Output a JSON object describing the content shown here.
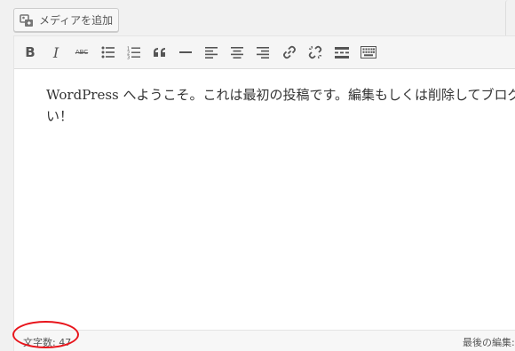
{
  "media_button": {
    "label": "メディアを追加",
    "icon": "add-media-icon"
  },
  "toolbar": {
    "buttons": [
      {
        "name": "bold",
        "icon": "bold-icon",
        "glyph": "B"
      },
      {
        "name": "italic",
        "icon": "italic-icon",
        "glyph": "I"
      },
      {
        "name": "strikethrough",
        "icon": "strikethrough-icon",
        "glyph": "ABC"
      },
      {
        "name": "bullet-list",
        "icon": "bullet-list-icon"
      },
      {
        "name": "numbered-list",
        "icon": "numbered-list-icon"
      },
      {
        "name": "blockquote",
        "icon": "blockquote-icon",
        "glyph": "“"
      },
      {
        "name": "horizontal-line",
        "icon": "horizontal-line-icon"
      },
      {
        "name": "align-left",
        "icon": "align-left-icon"
      },
      {
        "name": "align-center",
        "icon": "align-center-icon"
      },
      {
        "name": "align-right",
        "icon": "align-right-icon"
      },
      {
        "name": "insert-link",
        "icon": "link-icon"
      },
      {
        "name": "remove-link",
        "icon": "unlink-icon"
      },
      {
        "name": "read-more",
        "icon": "read-more-icon"
      },
      {
        "name": "toolbar-toggle",
        "icon": "keyboard-icon"
      }
    ]
  },
  "content": {
    "line1": "WordPress へようこそ。これは最初の投稿です。編集もしくは削除してブログを始",
    "line2": "い！"
  },
  "statusbar": {
    "word_count": "文字数: 47",
    "last_edited": "最後の編集:"
  },
  "colors": {
    "highlight": "#e8141b",
    "toolbar_bg": "#f5f5f5",
    "icon": "#555555"
  }
}
